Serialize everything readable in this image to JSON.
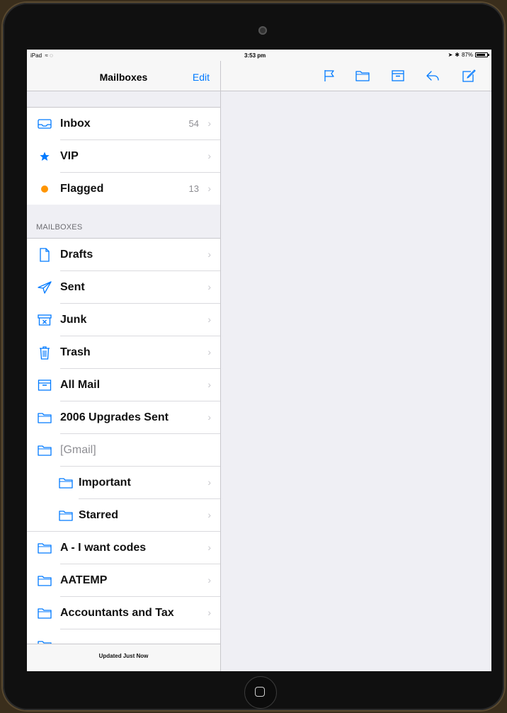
{
  "statusbar": {
    "device": "iPad",
    "time": "3:53 pm",
    "battery": "87%",
    "battery_level": 0.87
  },
  "left_nav": {
    "title": "Mailboxes",
    "edit_label": "Edit"
  },
  "top_list": [
    {
      "label": "Inbox",
      "count": "54",
      "icon": "inbox-icon"
    },
    {
      "label": "VIP",
      "count": "",
      "icon": "star-icon"
    },
    {
      "label": "Flagged",
      "count": "13",
      "icon": "flag-dot-icon"
    }
  ],
  "mailboxes_header": "MAILBOXES",
  "mailboxes": [
    {
      "label": "Drafts",
      "icon": "drafts-icon"
    },
    {
      "label": "Sent",
      "icon": "sent-icon"
    },
    {
      "label": "Junk",
      "icon": "junk-icon"
    },
    {
      "label": "Trash",
      "icon": "trash-icon"
    },
    {
      "label": "All Mail",
      "icon": "archive-icon"
    },
    {
      "label": "2006 Upgrades Sent",
      "icon": "folder-icon"
    },
    {
      "label": "[Gmail]",
      "icon": "folder-icon"
    },
    {
      "label": "Important",
      "icon": "folder-icon"
    },
    {
      "label": "Starred",
      "icon": "folder-icon"
    },
    {
      "label": "A - I want codes",
      "icon": "folder-icon"
    },
    {
      "label": "AATEMP",
      "icon": "folder-icon"
    },
    {
      "label": "Accountants and Tax",
      "icon": "folder-icon"
    }
  ],
  "footer": {
    "status": "Updated Just Now"
  },
  "right_toolbar": {
    "icons": [
      "flag-icon",
      "folder-icon",
      "archive-icon",
      "reply-icon",
      "compose-icon"
    ]
  },
  "colors": {
    "accent": "#007aff",
    "flag": "#ff9500"
  }
}
